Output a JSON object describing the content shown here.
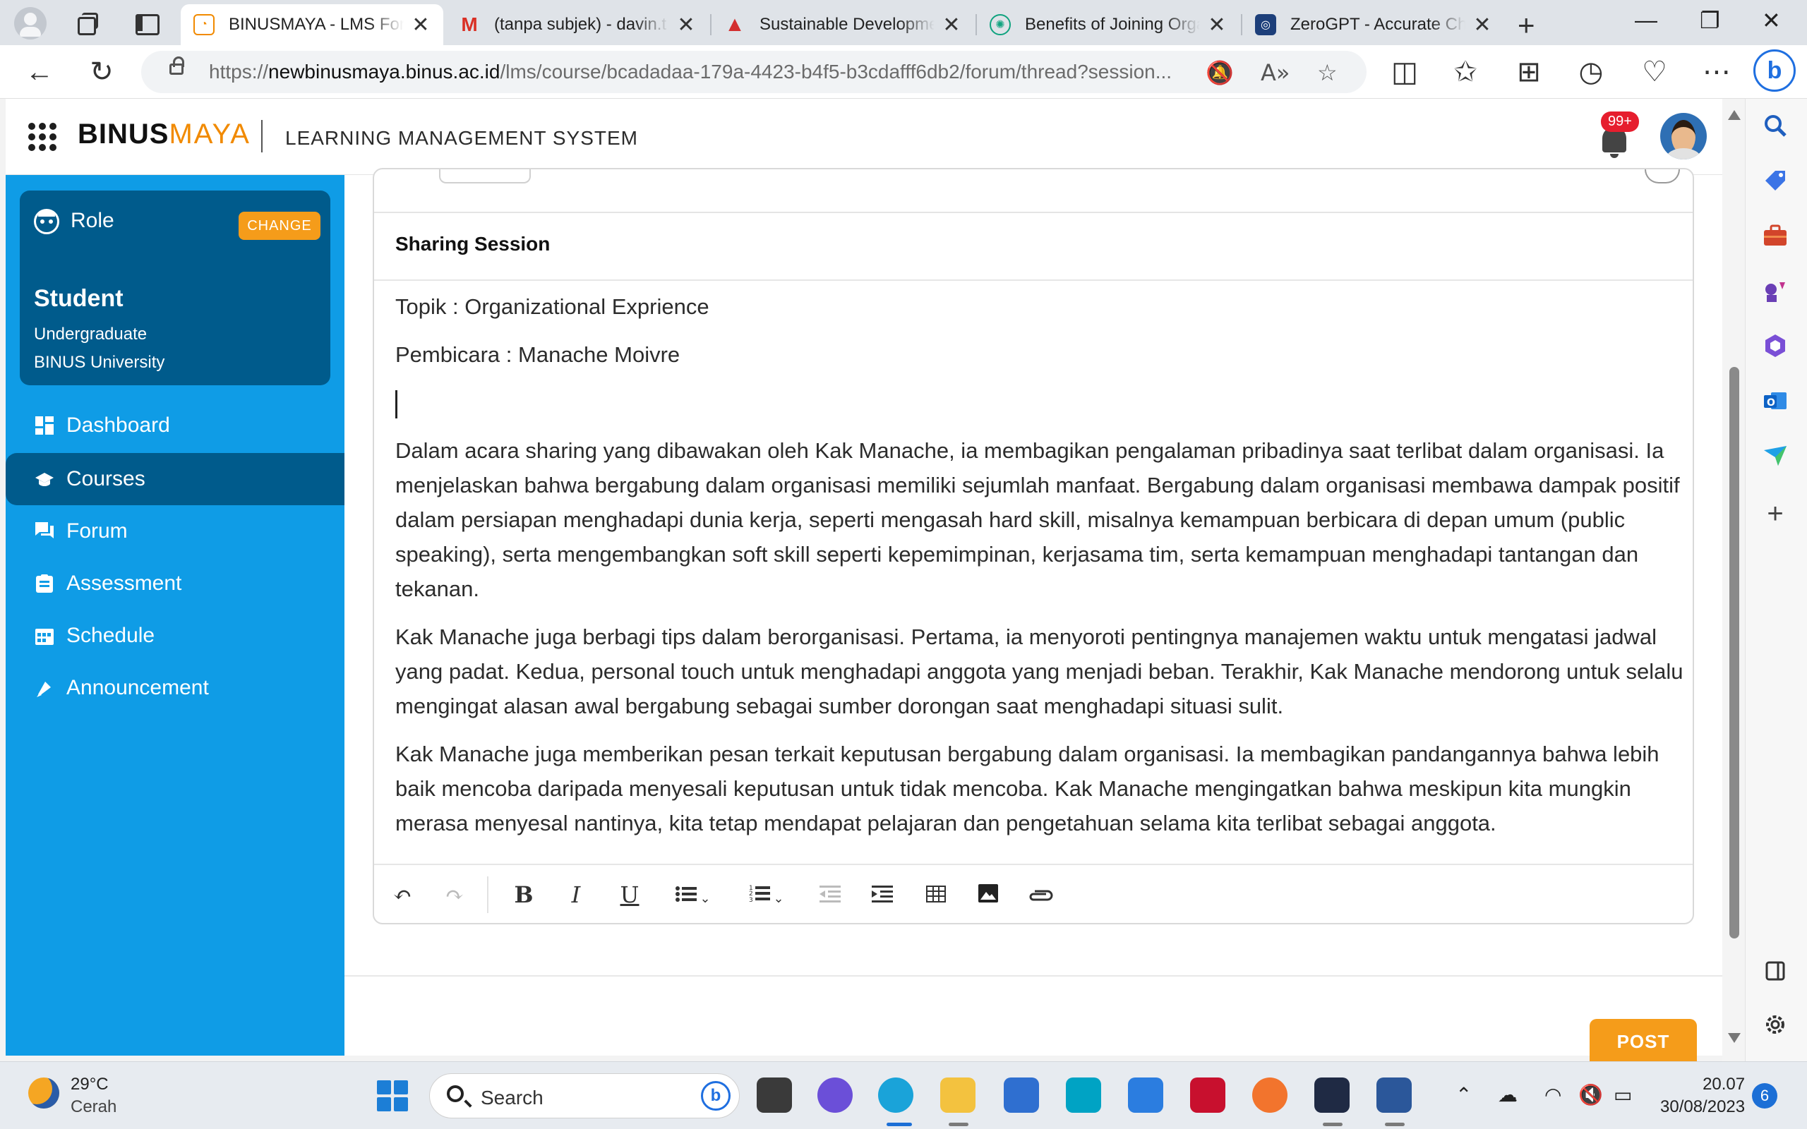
{
  "browser": {
    "tabs": [
      {
        "title": "BINUSMAYA - LMS Forum",
        "active": true
      },
      {
        "title": "(tanpa subjek) - davin.t",
        "active": false
      },
      {
        "title": "Sustainable Development",
        "active": false
      },
      {
        "title": "Benefits of Joining Organi",
        "active": false
      },
      {
        "title": "ZeroGPT - Accurate Chat",
        "active": false
      }
    ],
    "url_prefix": "https://",
    "url_domain": "newbinusmaya.binus.ac.id",
    "url_path": "/lms/course/bcadadaa-179a-4423-b4f5-b3cdafff6db2/forum/thread?session...",
    "new_tab": "+",
    "close_glyph": "✕"
  },
  "app": {
    "logo_binus": "BINUS",
    "logo_maya": "MAYA",
    "system_title": "LEARNING MANAGEMENT SYSTEM",
    "notification_badge": "99+"
  },
  "role": {
    "label": "Role",
    "change_label": "CHANGE",
    "name": "Student",
    "level": "Undergraduate",
    "institution": "BINUS University"
  },
  "nav": {
    "items": [
      {
        "label": "Dashboard",
        "icon": "dashboard-icon"
      },
      {
        "label": "Courses",
        "icon": "graduation-cap-icon",
        "active": true
      },
      {
        "label": "Forum",
        "icon": "chat-icon"
      },
      {
        "label": "Assessment",
        "icon": "clipboard-icon"
      },
      {
        "label": "Schedule",
        "icon": "calendar-icon"
      },
      {
        "label": "Announcement",
        "icon": "megaphone-icon"
      }
    ]
  },
  "editor": {
    "section_title": "Sharing Session",
    "topic": "Topik : Organizational Exprience",
    "speaker": "Pembicara : Manache Moivre",
    "paragraphs": [
      "Dalam acara sharing yang dibawakan oleh Kak Manache, ia membagikan pengalaman pribadinya saat terlibat dalam organisasi. Ia menjelaskan bahwa bergabung dalam organisasi memiliki sejumlah manfaat. Bergabung dalam organisasi membawa dampak positif dalam persiapan menghadapi dunia kerja, seperti mengasah hard skill, misalnya kemampuan berbicara di depan umum (public speaking), serta mengembangkan soft skill seperti kepemimpinan, kerjasama tim, serta kemampuan menghadapi tantangan dan tekanan.",
      "Kak Manache juga berbagi tips dalam berorganisasi. Pertama, ia menyoroti pentingnya manajemen waktu untuk mengatasi jadwal yang padat. Kedua, personal touch untuk menghadapi anggota yang menjadi beban. Terakhir, Kak Manache mendorong untuk selalu mengingat alasan awal bergabung sebagai sumber dorongan saat menghadapi situasi sulit.",
      "Kak Manache juga memberikan pesan terkait keputusan bergabung dalam organisasi. Ia membagikan pandangannya bahwa lebih baik mencoba daripada menyesali keputusan untuk tidak mencoba. Kak Manache mengingatkan bahwa meskipun kita mungkin merasa menyesal nantinya, kita tetap mendapat pelajaran dan pengetahuan selama kita terlibat sebagai anggota."
    ],
    "toolbar": {
      "undo": "↶",
      "redo": "↷",
      "bold": "B",
      "italic": "I",
      "underline": "U",
      "dropdown": "⌄"
    },
    "post_label": "POST"
  },
  "taskbar": {
    "temperature": "29°C",
    "weather": "Cerah",
    "search_label": "Search",
    "time": "20.07",
    "date": "30/08/2023",
    "notification_count": "6"
  },
  "colors": {
    "nav_bg": "#0f9ce6",
    "nav_active": "#005b8c",
    "accent": "#f59c1a",
    "badge": "#e61e2e"
  }
}
